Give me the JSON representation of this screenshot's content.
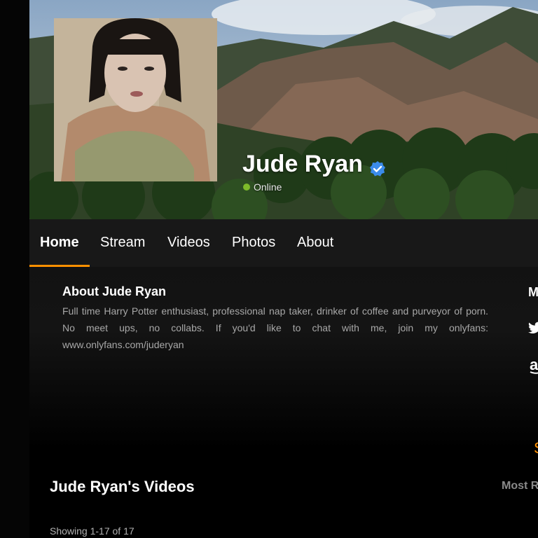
{
  "profile": {
    "name": "Jude Ryan",
    "status": "Online",
    "verified": true
  },
  "nav": {
    "tabs": [
      {
        "label": "Home",
        "active": true
      },
      {
        "label": "Stream",
        "active": false
      },
      {
        "label": "Videos",
        "active": false
      },
      {
        "label": "Photos",
        "active": false
      },
      {
        "label": "About",
        "active": false
      }
    ]
  },
  "about": {
    "title": "About Jude Ryan",
    "body": "Full time Harry Potter enthusiast, professional nap taker, drinker of coffee and purveyor of porn. No meet ups, no collabs. If you'd like to chat with me, join my onlyfans: www.onlyfans.com/juderyan"
  },
  "sidebar": {
    "heading_partial": "M",
    "icons": [
      "twitter-icon",
      "amazon-icon"
    ],
    "orange_partial": "S"
  },
  "videos": {
    "title": "Jude Ryan's Videos",
    "sort_label": "Most R",
    "showing": "Showing 1-17 of 17"
  },
  "colors": {
    "accent": "#ff9000",
    "online": "#7dbb2a",
    "verified": "#3b8beb"
  }
}
